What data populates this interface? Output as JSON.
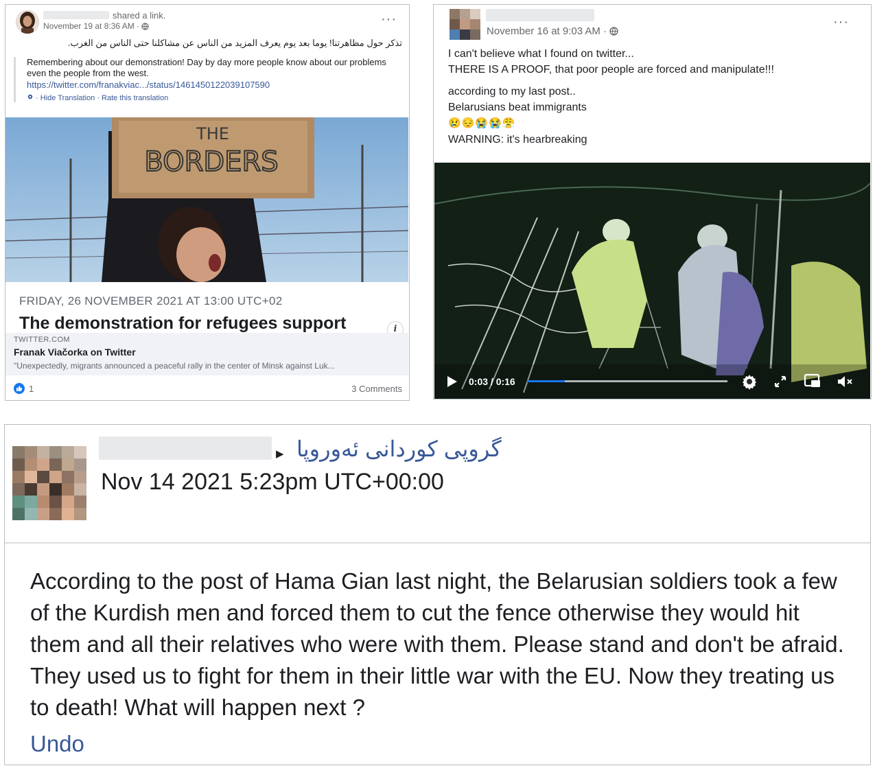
{
  "post1": {
    "action_text": "shared a link.",
    "date": "November 19 at 8:36 AM ·",
    "arabic_text": "تذكر حول مظاهرتنا! يوما بعد يوم يعرف المزيد من الناس عن مشاكلنا حتى الناس من الغرب.",
    "translation": "Remembering about our demonstration! Day by day more people know about our problems even the people from the west.",
    "link": "https://twitter.com/franakviac.../status/1461450122039107590",
    "hide_translation": "· Hide Translation · Rate this translation",
    "sign_text": "THE BORDERS",
    "event_date": "FRIDAY, 26 NOVEMBER 2021 AT 13:00 UTC+02",
    "event_title": "The demonstration for refugees support",
    "link_domain": "TWITTER.COM",
    "link_title": "Franak Viačorka on Twitter",
    "link_description": "\"Unexpectedly, migrants announced a peaceful rally in the center of Minsk against Luk...",
    "reactions_count": "1",
    "comments": "3 Comments",
    "info_icon": "i"
  },
  "post2": {
    "date": "November 16 at 9:03 AM ·",
    "line1": "I can't believe what I found on twitter...",
    "line2": "THERE IS A PROOF, that poor people are forced and manipulate!!!",
    "line3": "according to my last post..",
    "line4": "Belarusians beat immigrants",
    "emojis": "😢😔😭😭😤",
    "line5": "WARNING: it's hearbreaking",
    "video_time": "0:03 / 0:16",
    "video_progress": 0.19
  },
  "post3": {
    "arrow": "▶",
    "group_name": "گروپی کوردانی ئەوروپا",
    "date": "Nov 14 2021 5:23pm UTC+00:00",
    "body": "According to the post of Hama Gian last night, the Belarusian soldiers took a few of the Kurdish men and forced them to cut the fence otherwise they would hit them and all their relatives who were with them. Please stand and don't be afraid. They used us to fight for them in their little war with the EU. Now they treating us to death! What will happen next ?",
    "undo": "Undo"
  },
  "colors": {
    "link": "#385898",
    "facebook_blue": "#1877f2",
    "meta_gray": "#65676b"
  }
}
